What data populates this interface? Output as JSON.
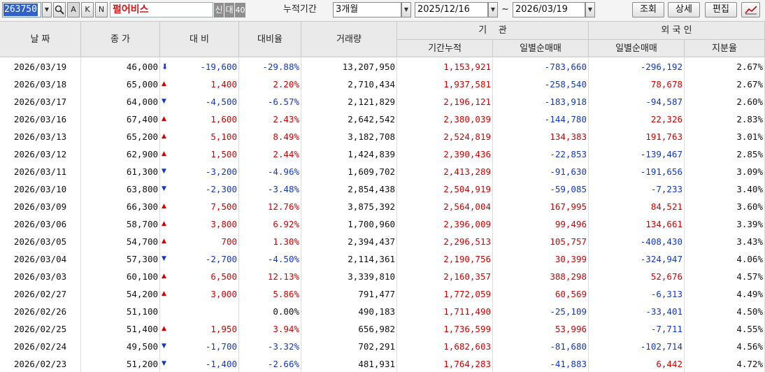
{
  "toolbar": {
    "code": "263750",
    "btn_search_glyph": "🔎",
    "btn_a": "A",
    "btn_k": "K",
    "btn_n": "N",
    "stock_name": "펄어비스",
    "tag_new": "신",
    "tag_loan": "대",
    "tag_margin": "40",
    "period_label": "누적기간",
    "period_value": "3개월",
    "start_date": "2025/12/16",
    "tilde": "~",
    "end_date": "2026/03/19",
    "query_button": "조회",
    "detail_button": "상세",
    "edit_button": "편집"
  },
  "headers": {
    "date": "날 짜",
    "close": "종 가",
    "change": "대 비",
    "change_rate": "대비율",
    "volume": "거래량",
    "institution": "기    관",
    "inst_cumulative": "기간누적",
    "inst_daily": "일별순매매",
    "foreign": "외 국 인",
    "foreign_daily": "일별순매매",
    "foreign_ratio": "지분율"
  },
  "colors": {
    "up": "#d40000",
    "down": "#1037c8",
    "header_bg": "#eaeaea",
    "code_highlight": "#2f61c9"
  },
  "rows": [
    {
      "date": "2026/03/19",
      "close": "46,000",
      "dir": "lower_limit",
      "change": "-19,600",
      "rate": "-29.88%",
      "volume": "13,207,950",
      "inst_cum": "1,153,921",
      "inst_daily": "-783,660",
      "frgn_daily": "-296,192",
      "frgn_ratio": "2.67%"
    },
    {
      "date": "2026/03/18",
      "close": "65,000",
      "dir": "up",
      "change": "1,400",
      "rate": "2.20%",
      "volume": "2,710,434",
      "inst_cum": "1,937,581",
      "inst_daily": "-258,540",
      "frgn_daily": "78,678",
      "frgn_ratio": "2.67%"
    },
    {
      "date": "2026/03/17",
      "close": "64,000",
      "dir": "down",
      "change": "-4,500",
      "rate": "-6.57%",
      "volume": "2,121,829",
      "inst_cum": "2,196,121",
      "inst_daily": "-183,918",
      "frgn_daily": "-94,587",
      "frgn_ratio": "2.60%"
    },
    {
      "date": "2026/03/16",
      "close": "67,400",
      "dir": "up",
      "change": "1,600",
      "rate": "2.43%",
      "volume": "2,642,542",
      "inst_cum": "2,380,039",
      "inst_daily": "-144,780",
      "frgn_daily": "22,326",
      "frgn_ratio": "2.83%"
    },
    {
      "date": "2026/03/13",
      "close": "65,200",
      "dir": "up",
      "change": "5,100",
      "rate": "8.49%",
      "volume": "3,182,708",
      "inst_cum": "2,524,819",
      "inst_daily": "134,383",
      "frgn_daily": "191,763",
      "frgn_ratio": "3.01%"
    },
    {
      "date": "2026/03/12",
      "close": "62,900",
      "dir": "up",
      "change": "1,500",
      "rate": "2.44%",
      "volume": "1,424,839",
      "inst_cum": "2,390,436",
      "inst_daily": "-22,853",
      "frgn_daily": "-139,467",
      "frgn_ratio": "2.85%"
    },
    {
      "date": "2026/03/11",
      "close": "61,300",
      "dir": "down",
      "change": "-3,200",
      "rate": "-4.96%",
      "volume": "1,609,702",
      "inst_cum": "2,413,289",
      "inst_daily": "-91,630",
      "frgn_daily": "-191,656",
      "frgn_ratio": "3.09%"
    },
    {
      "date": "2026/03/10",
      "close": "63,800",
      "dir": "down",
      "change": "-2,300",
      "rate": "-3.48%",
      "volume": "2,854,438",
      "inst_cum": "2,504,919",
      "inst_daily": "-59,085",
      "frgn_daily": "-7,233",
      "frgn_ratio": "3.40%"
    },
    {
      "date": "2026/03/09",
      "close": "66,300",
      "dir": "up",
      "change": "7,500",
      "rate": "12.76%",
      "volume": "3,875,392",
      "inst_cum": "2,564,004",
      "inst_daily": "167,995",
      "frgn_daily": "84,521",
      "frgn_ratio": "3.60%"
    },
    {
      "date": "2026/03/06",
      "close": "58,700",
      "dir": "up",
      "change": "3,800",
      "rate": "6.92%",
      "volume": "1,700,960",
      "inst_cum": "2,396,009",
      "inst_daily": "99,496",
      "frgn_daily": "134,661",
      "frgn_ratio": "3.39%"
    },
    {
      "date": "2026/03/05",
      "close": "54,700",
      "dir": "up",
      "change": "700",
      "rate": "1.30%",
      "volume": "2,394,437",
      "inst_cum": "2,296,513",
      "inst_daily": "105,757",
      "frgn_daily": "-408,430",
      "frgn_ratio": "3.43%"
    },
    {
      "date": "2026/03/04",
      "close": "57,300",
      "dir": "down",
      "change": "-2,700",
      "rate": "-4.50%",
      "volume": "2,114,361",
      "inst_cum": "2,190,756",
      "inst_daily": "30,399",
      "frgn_daily": "-324,947",
      "frgn_ratio": "4.06%"
    },
    {
      "date": "2026/03/03",
      "close": "60,100",
      "dir": "up",
      "change": "6,500",
      "rate": "12.13%",
      "volume": "3,339,810",
      "inst_cum": "2,160,357",
      "inst_daily": "388,298",
      "frgn_daily": "52,676",
      "frgn_ratio": "4.57%"
    },
    {
      "date": "2026/02/27",
      "close": "54,200",
      "dir": "up",
      "change": "3,000",
      "rate": "5.86%",
      "volume": "791,477",
      "inst_cum": "1,772,059",
      "inst_daily": "60,569",
      "frgn_daily": "-6,313",
      "frgn_ratio": "4.49%"
    },
    {
      "date": "2026/02/26",
      "close": "51,100",
      "dir": "flat",
      "change": "",
      "rate": "0.00%",
      "volume": "490,183",
      "inst_cum": "1,711,490",
      "inst_daily": "-25,109",
      "frgn_daily": "-33,401",
      "frgn_ratio": "4.50%"
    },
    {
      "date": "2026/02/25",
      "close": "51,400",
      "dir": "up",
      "change": "1,950",
      "rate": "3.94%",
      "volume": "656,982",
      "inst_cum": "1,736,599",
      "inst_daily": "53,996",
      "frgn_daily": "-7,711",
      "frgn_ratio": "4.55%"
    },
    {
      "date": "2026/02/24",
      "close": "49,500",
      "dir": "down",
      "change": "-1,700",
      "rate": "-3.32%",
      "volume": "702,291",
      "inst_cum": "1,682,603",
      "inst_daily": "-81,680",
      "frgn_daily": "-102,714",
      "frgn_ratio": "4.56%"
    },
    {
      "date": "2026/02/23",
      "close": "51,200",
      "dir": "down",
      "change": "-1,400",
      "rate": "-2.66%",
      "volume": "481,931",
      "inst_cum": "1,764,283",
      "inst_daily": "-41,883",
      "frgn_daily": "6,442",
      "frgn_ratio": "4.72%"
    }
  ]
}
